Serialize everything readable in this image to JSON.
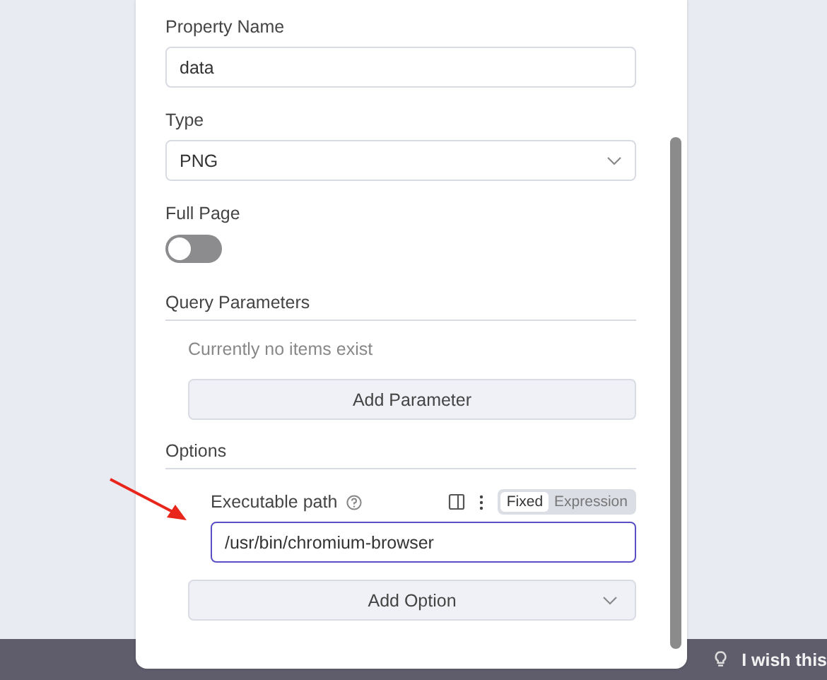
{
  "panel": {
    "property_name": {
      "label": "Property Name",
      "value": "data"
    },
    "type": {
      "label": "Type",
      "value": "PNG"
    },
    "full_page": {
      "label": "Full Page",
      "on": false
    },
    "query_parameters": {
      "title": "Query Parameters",
      "empty_text": "Currently no items exist",
      "button": "Add Parameter"
    },
    "options": {
      "title": "Options",
      "executable_path": {
        "label": "Executable path",
        "value": "/usr/bin/chromium-browser",
        "modes": [
          {
            "label": "Fixed",
            "selected": true
          },
          {
            "label": "Expression",
            "selected": false
          }
        ]
      },
      "button": "Add Option"
    }
  },
  "banner": {
    "text": "I wish this"
  }
}
